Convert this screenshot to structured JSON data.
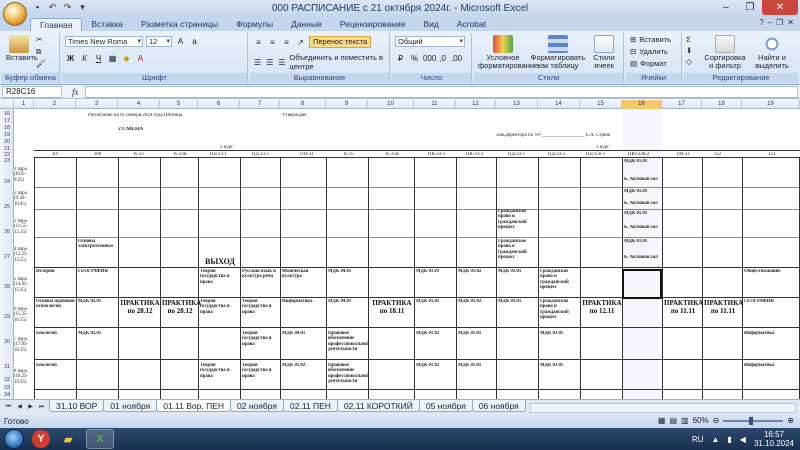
{
  "window": {
    "title": "000 РАСПИСАНИЕ с 21 октября 2024г. - Microsoft Excel"
  },
  "ribbon_tabs": [
    "Главная",
    "Вставка",
    "Разметка страницы",
    "Формулы",
    "Данные",
    "Рецензирование",
    "Вид",
    "Acrobat"
  ],
  "ribbon": {
    "clipboard": {
      "paste": "Вставить",
      "label": "Буфер обмена"
    },
    "font": {
      "name": "Times New Roma",
      "size": "12",
      "label": "Шрифт"
    },
    "alignment": {
      "wrap": "Перенос текста",
      "merge": "Объединить и поместить в центре",
      "label": "Выравнивание"
    },
    "number": {
      "format": "Общий",
      "label": "Число"
    },
    "styles": {
      "cond": "Условное форматирование",
      "table": "Форматировать как таблицу",
      "cell_styles": "Стили ячеек",
      "label": "Стили"
    },
    "cells": {
      "insert": "Вставить",
      "delete": "Удалить",
      "format": "Формат",
      "label": "Ячейки"
    },
    "editing": {
      "sort": "Сортировка и фильтр",
      "find": "Найти и выделить",
      "label": "Редактирование"
    }
  },
  "formula_bar": {
    "name_box": "R28C16",
    "fx": "fx",
    "content": ""
  },
  "columns": [
    "1",
    "2",
    "3",
    "4",
    "5",
    "6",
    "7",
    "8",
    "9",
    "10",
    "11",
    "12",
    "13",
    "14",
    "15",
    "16",
    "17",
    "18",
    "19"
  ],
  "active_column": "16",
  "rows": [
    "16",
    "17",
    "18",
    "19",
    "20",
    "21",
    "22",
    "23",
    "24",
    "25",
    "26",
    "27",
    "28",
    "29",
    "30",
    "31",
    "32",
    "33",
    "34"
  ],
  "sheet": {
    "header_line": "Расписание на 01 ноября 2024 года Пятница",
    "approved": "Утверждаю",
    "shift": "2 СМЕНА",
    "deputy": "Зам.директора по УР _________________ Е.А. Стрюк",
    "course2": "2 курс",
    "course3": "3 курс",
    "groups": [
      "307",
      "306",
      "К-33",
      "К-33м",
      "ПД 33-1",
      "ПД 33-2",
      "ОП-33",
      "К-35",
      "К-35м",
      "ПК-33-3",
      "ПК-33-3",
      "ПД-23-1",
      "ПД-23-2",
      "ПД 25б-1",
      "ПЮ-23б-2",
      "ТМ-23",
      "322",
      "323"
    ],
    "pairs": [
      "1 пара (8.05-9.25)",
      "2 пара (9.30-10.45)",
      "3 пара (11.55-12.15)",
      "4 пара (12.25-13.55)",
      "5 пара (14.05-15.35)",
      "6 пара (15.25-16.55)",
      "7 пара (17.05-18.15)",
      "8 пара (18.25-19.35)"
    ],
    "big_texts": {
      "vyhod": "ВЫХОД",
      "practice1": "ПРАКТИКА по 28.12",
      "practice2": "ПРАКТИКА по 28.12",
      "practice3": "ПРАКТИКА по 18.11",
      "practice4": "ПРАКТИКА по 12.11",
      "practice5": "ПРАКТИКА по 11.11",
      "practice6": "ПРАКТИКА по 11.11"
    },
    "cells": {
      "osnovy": "Основы электротехники",
      "istoriya": "История",
      "geografia": "ГЕОГРАФИЯ",
      "osnovy2": "Основы правовой психологии",
      "mdk0201": "МДК 02.01",
      "biologia": "Биология",
      "teoria1": "Теория государства и права",
      "teoria2": "Теория государства и права",
      "teoria3": "Теория государства и права",
      "russkiy": "Русский язык и культура речи",
      "fizkult": "Физическая культура",
      "informatika": "Информатика",
      "mdk0401": "МДК 04.01",
      "mdk0102": "МДК 01.02",
      "pravovoe": "Правовое обеспечение профессиональной деятельности",
      "mdk0101": "МДК 01.01",
      "grazhd1": "Гражданское право и гражданский процесс",
      "grazhd2": "Гражданское право и гражданский процесс",
      "grazhd3": "Гражданское право и гражданский процесс",
      "mdk0301": "МДК 03.01",
      "aktovyi": "Б. Актовый зал",
      "obshestvo": "Обществознание",
      "geografia2": "ГЕОГРАФИЯ",
      "informatika2": "Информатика"
    }
  },
  "sheet_tabs": [
    "31.10 ВОР",
    "01 ноября",
    "01.11 Вор, ПЕН",
    "02 ноября",
    "02.11 ПЕН",
    "02.11 КОРОТКИЙ",
    "05 ноября",
    "06 ноября"
  ],
  "active_sheet_tab": "01.11 Вор, ПЕН",
  "status": {
    "ready": "Готово",
    "zoom": "60%"
  },
  "taskbar": {
    "lang": "RU",
    "time": "16:57",
    "date": "31.10.2024"
  }
}
